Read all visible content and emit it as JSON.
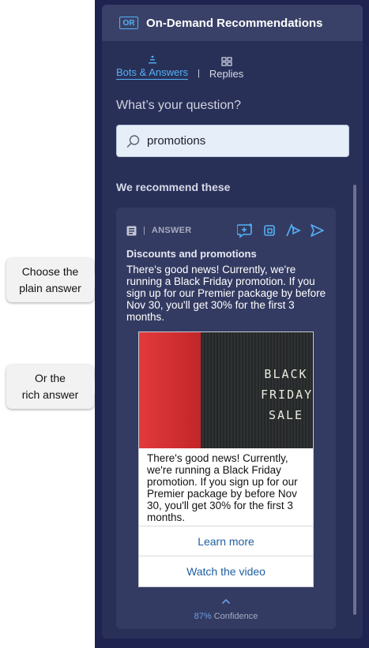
{
  "annotations": {
    "plain": [
      "Choose the",
      "plain answer"
    ],
    "rich": [
      "Or the",
      "rich answer"
    ]
  },
  "header": {
    "badge": "OR",
    "title": "On-Demand Recommendations"
  },
  "tabs": [
    {
      "label": "Bots & Answers",
      "active": true
    },
    {
      "label": "Replies",
      "active": false
    }
  ],
  "tab_separator": "|",
  "question_label": "What’s your question?",
  "search": {
    "value": "promotions"
  },
  "recommend_label": "We recommend these",
  "card": {
    "separator": "|",
    "type_label": "ANSWER",
    "title": "Discounts and promotions",
    "text": "There's good news! Currently, we're running a Black Friday promotion. If you sign up for our Premier package by before Nov 30, you'll get 30% for the first 3 months.",
    "rich": {
      "image_text": [
        "BLACK",
        "FRIDAY",
        "SALE"
      ],
      "text": "There's good news! Currently, we're running a Black Friday promotion. If you sign up for our Premier package by before Nov 30, you'll get 30% for the first 3 months.",
      "links": [
        "Learn more",
        "Watch the video"
      ]
    },
    "confidence_pct": "87%",
    "confidence_label": "Confidence"
  },
  "colors": {
    "panel_bg": "#293058",
    "header_bg": "#3a4168",
    "accent": "#53b1f5",
    "link": "#1f5fa0"
  }
}
